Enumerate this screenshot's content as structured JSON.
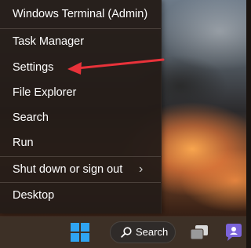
{
  "menu": {
    "items": [
      {
        "label": "Windows Terminal (Admin)"
      },
      {
        "label": "Task Manager"
      },
      {
        "label": "Settings"
      },
      {
        "label": "File Explorer"
      },
      {
        "label": "Search"
      },
      {
        "label": "Run"
      },
      {
        "label": "Shut down or sign out",
        "has_submenu": true
      },
      {
        "label": "Desktop"
      }
    ],
    "submenu_glyph": "›"
  },
  "annotation": {
    "arrow_color": "#e8323a",
    "points_to": "Settings"
  },
  "taskbar": {
    "start_icon": "windows-logo-icon",
    "search_label": "Search",
    "search_icon": "search-icon",
    "task_view_icon": "task-view-icon",
    "chat_icon": "chat-icon",
    "accent_color": "#2fa4f2"
  }
}
